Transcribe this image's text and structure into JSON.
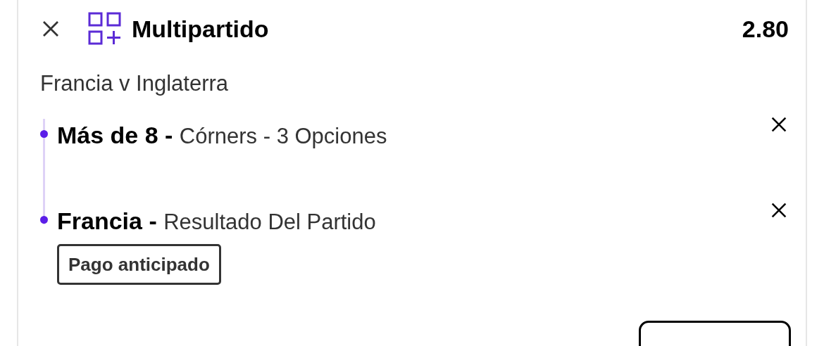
{
  "header": {
    "title": "Multipartido",
    "odds": "2.80"
  },
  "event": "Francia v Inglaterra",
  "legs": [
    {
      "selection": "Más de 8 -",
      "market": "Córners - 3 Opciones"
    },
    {
      "selection": "Francia -",
      "market": "Resultado Del Partido",
      "badge": "Pago anticipado"
    }
  ]
}
